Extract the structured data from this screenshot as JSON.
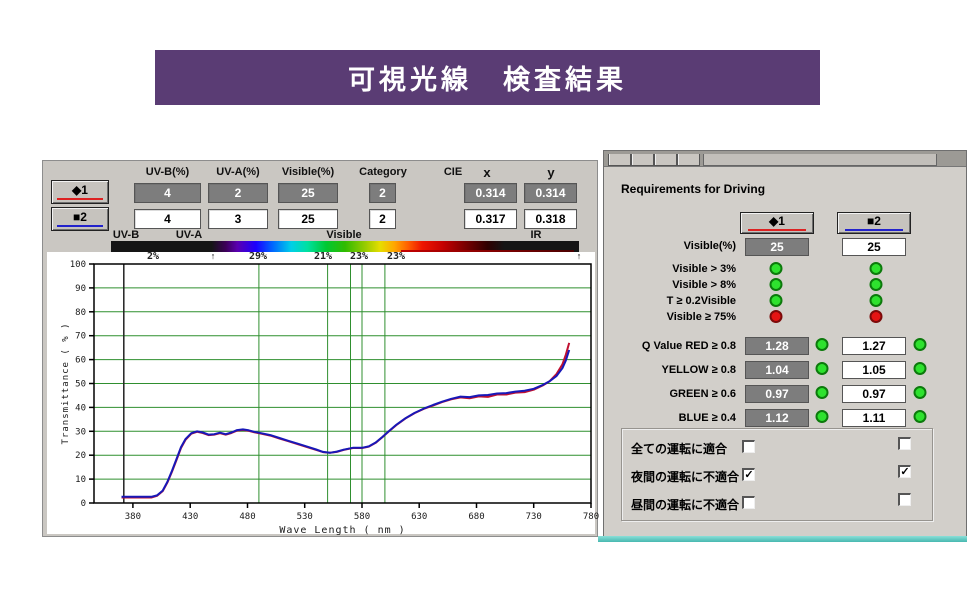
{
  "banner": {
    "title": "可視光線　検査結果"
  },
  "panel": {
    "headers": {
      "uvb": "UV-B(%)",
      "uva": "UV-A(%)",
      "visible": "Visible(%)",
      "category": "Category",
      "cie": "CIE",
      "x": "x",
      "y": "y"
    },
    "rows": [
      {
        "label": "◆1",
        "uvb": "4",
        "uva": "2",
        "visible": "25",
        "category": "2",
        "cie_x": "0.314",
        "cie_y": "0.314"
      },
      {
        "label": "■2",
        "uvb": "4",
        "uva": "3",
        "visible": "25",
        "category": "2",
        "cie_x": "0.317",
        "cie_y": "0.318"
      }
    ],
    "spectrum_labels": {
      "uvb": "UV-B",
      "uva": "UV-A",
      "visible": "Visible",
      "ir": "IR"
    },
    "band_percentages": [
      "2%",
      "29%",
      "21%",
      "23%",
      "23%"
    ],
    "marker": "↑"
  },
  "chart_data": {
    "type": "line",
    "xlabel": "Wave Length ( nm )",
    "ylabel": "Transmittance ( % )",
    "xlim": [
      346,
      780
    ],
    "ylim": [
      0,
      100
    ],
    "x_ticks": [
      380,
      430,
      480,
      530,
      580,
      630,
      680,
      730,
      780
    ],
    "y_ticks": [
      0,
      10,
      20,
      30,
      40,
      50,
      60,
      70,
      80,
      90,
      100
    ],
    "band_lines_nm": [
      490,
      550,
      570,
      580,
      600
    ],
    "uv_line_nm": 372,
    "grid": true,
    "x": [
      370,
      396,
      401,
      406,
      410,
      414,
      418,
      422,
      426,
      431,
      436,
      441,
      446,
      451,
      456,
      461,
      466,
      471,
      476,
      481,
      486,
      492,
      500,
      508,
      516,
      524,
      532,
      540,
      546,
      552,
      558,
      564,
      572,
      580,
      586,
      592,
      598,
      604,
      610,
      618,
      626,
      634,
      642,
      650,
      658,
      666,
      674,
      682,
      690,
      698,
      706,
      714,
      722,
      730,
      738,
      744,
      750,
      755,
      758,
      761
    ],
    "series": [
      {
        "name": "1",
        "color": "#c01030",
        "values": [
          2.3,
          2.3,
          3.0,
          5.0,
          8.5,
          13,
          18,
          23,
          26.5,
          29,
          29.8,
          29.3,
          28.4,
          28.6,
          29.2,
          28.6,
          29.3,
          30.3,
          30.6,
          30.2,
          29.6,
          29.0,
          28.2,
          27.0,
          25.8,
          24.6,
          23.4,
          22.2,
          21.3,
          21.0,
          21.4,
          22.2,
          23.0,
          23.0,
          23.6,
          25.2,
          27.6,
          30.2,
          32.6,
          35.4,
          37.6,
          39.4,
          40.8,
          42.2,
          43.4,
          44.2,
          43.8,
          44.6,
          44.4,
          45.4,
          45.4,
          46.2,
          46.4,
          47.4,
          49.2,
          51.0,
          54.0,
          58.0,
          62.0,
          67.0
        ]
      },
      {
        "name": "2",
        "color": "#1818b8",
        "values": [
          2.6,
          2.6,
          3.2,
          5.2,
          8.8,
          13.4,
          18.4,
          23.4,
          26.8,
          29.2,
          30.0,
          29.5,
          28.6,
          28.8,
          29.4,
          28.8,
          29.5,
          30.5,
          30.8,
          30.4,
          29.8,
          29.2,
          28.4,
          27.2,
          26.0,
          24.8,
          23.6,
          22.4,
          21.4,
          21.0,
          21.5,
          22.3,
          23.1,
          23.1,
          23.7,
          25.3,
          27.7,
          30.3,
          32.7,
          35.5,
          37.7,
          39.5,
          41.0,
          42.4,
          43.6,
          44.5,
          44.3,
          45.0,
          45.2,
          45.8,
          46.0,
          46.6,
          47.0,
          47.8,
          49.4,
          51.0,
          53.2,
          56.4,
          59.6,
          64.0
        ]
      }
    ]
  },
  "driving": {
    "heading": "Requirements for Driving",
    "col1_label": "◆1",
    "col2_label": "■2",
    "visible_row": {
      "label": "Visible(%)",
      "v1": "25",
      "v2": "25"
    },
    "criteria": [
      {
        "label": "Visible > 3%",
        "s1": "green",
        "s2": "green"
      },
      {
        "label": "Visible > 8%",
        "s1": "green",
        "s2": "green"
      },
      {
        "label": "T ≥ 0.2Visible",
        "s1": "green",
        "s2": "green"
      },
      {
        "label": "Visible ≥ 75%",
        "s1": "red",
        "s2": "red"
      }
    ],
    "q_values": [
      {
        "label": "Q Value RED ≥ 0.8",
        "v1": "1.28",
        "v2": "1.27",
        "s1": "green",
        "s2": "green"
      },
      {
        "label": "YELLOW ≥ 0.8",
        "v1": "1.04",
        "v2": "1.05",
        "s1": "green",
        "s2": "green"
      },
      {
        "label": "GREEN ≥ 0.6",
        "v1": "0.97",
        "v2": "0.97",
        "s1": "green",
        "s2": "green"
      },
      {
        "label": "BLUE ≥ 0.4",
        "v1": "1.12",
        "v2": "1.11",
        "s1": "green",
        "s2": "green"
      }
    ],
    "checks": [
      {
        "label": "全ての運転に適合",
        "c1": false,
        "c2": false
      },
      {
        "label": "夜間の運転に不適合",
        "c1": true,
        "c2": true
      },
      {
        "label": "昼間の運転に不適合",
        "c1": false,
        "c2": false
      }
    ]
  },
  "colors": {
    "banner": "#5a3c74",
    "series1_underline": "#dd2222",
    "series2_underline": "#2222cc",
    "grid_green": "#2f8f2f",
    "pass_green": "#2ee22e",
    "fail_red": "#e41414"
  }
}
